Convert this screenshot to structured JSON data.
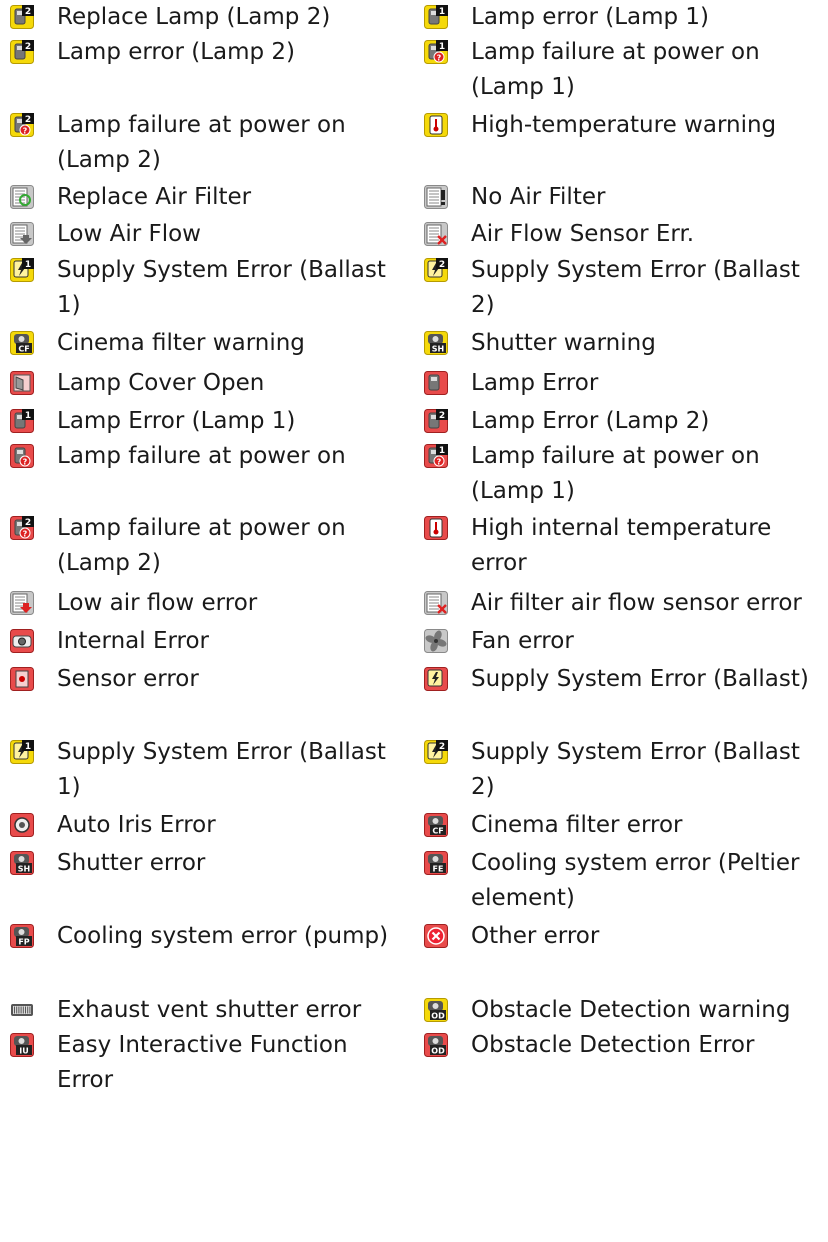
{
  "rows": [
    [
      {
        "label": "Replace Lamp (Lamp 2)",
        "icon": "lamp-2-warning-icon",
        "tone": "yellow",
        "glyph": "lamp",
        "badge": "2"
      },
      {
        "label": "Lamp error (Lamp 1)",
        "icon": "lamp-1-warning-icon",
        "tone": "yellow",
        "glyph": "lamp",
        "badge": "1"
      }
    ],
    [
      {
        "label": "Lamp error (Lamp 2)",
        "icon": "lamp-2-warning-icon",
        "tone": "yellow",
        "glyph": "lamp",
        "badge": "2"
      },
      {
        "label": "Lamp failure at power on (Lamp 1)",
        "icon": "lamp-1-failure-icon",
        "tone": "yellow",
        "glyph": "lamp-q",
        "badge": "1"
      }
    ],
    [
      {
        "label": "Lamp failure at power on (Lamp 2)",
        "icon": "lamp-2-failure-icon",
        "tone": "yellow",
        "glyph": "lamp-q",
        "badge": "2"
      },
      {
        "label": "High-temperature warning",
        "icon": "thermometer-warning-icon",
        "tone": "yellow",
        "glyph": "thermo"
      }
    ],
    [
      {
        "label": "Replace Air Filter",
        "icon": "replace-filter-icon",
        "tone": "gray",
        "glyph": "filter-cycle"
      },
      {
        "label": "No Air Filter",
        "icon": "no-filter-icon",
        "tone": "gray",
        "glyph": "filter-bang"
      }
    ],
    [
      {
        "label": "Low Air Flow",
        "icon": "low-airflow-icon",
        "tone": "gray",
        "glyph": "filter-down"
      },
      {
        "label": "Air Flow Sensor Err.",
        "icon": "airflow-sensor-error-icon",
        "tone": "gray",
        "glyph": "filter-x"
      }
    ],
    [
      {
        "label": "Supply System Error (Ballast 1)",
        "icon": "ballast-1-warning-icon",
        "tone": "yellow",
        "glyph": "bolt",
        "badge": "1"
      },
      {
        "label": "Supply System Error (Ballast 2)",
        "icon": "ballast-2-warning-icon",
        "tone": "yellow",
        "glyph": "bolt",
        "badge": "2"
      }
    ],
    [
      {
        "label": "Cinema filter warning",
        "icon": "cinema-filter-warning-icon",
        "tone": "yellow",
        "glyph": "code",
        "code": "CF"
      },
      {
        "label": "Shutter warning",
        "icon": "shutter-warning-icon",
        "tone": "yellow",
        "glyph": "code",
        "code": "SH"
      }
    ],
    [
      {
        "label": "Lamp Cover Open",
        "icon": "lamp-cover-open-icon",
        "tone": "red",
        "glyph": "cover"
      },
      {
        "label": "Lamp Error",
        "icon": "lamp-error-icon",
        "tone": "red",
        "glyph": "lamp"
      }
    ],
    [
      {
        "label": "Lamp Error (Lamp 1)",
        "icon": "lamp-1-error-icon",
        "tone": "red",
        "glyph": "lamp",
        "badge": "1"
      },
      {
        "label": "Lamp Error (Lamp 2)",
        "icon": "lamp-2-error-icon",
        "tone": "red",
        "glyph": "lamp",
        "badge": "2"
      }
    ],
    [
      {
        "label": "Lamp failure at power on",
        "icon": "lamp-failure-error-icon",
        "tone": "red",
        "glyph": "lamp-q"
      },
      {
        "label": "Lamp failure at power on (Lamp 1)",
        "icon": "lamp-1-failure-error-icon",
        "tone": "red",
        "glyph": "lamp-q",
        "badge": "1"
      }
    ],
    [
      {
        "label": "Lamp failure at power on (Lamp 2)",
        "icon": "lamp-2-failure-error-icon",
        "tone": "red",
        "glyph": "lamp-q",
        "badge": "2"
      },
      {
        "label": "High internal temperature error",
        "icon": "thermometer-error-icon",
        "tone": "red",
        "glyph": "thermo"
      }
    ],
    [
      {
        "label": "Low air flow error",
        "icon": "low-airflow-error-icon",
        "tone": "gray",
        "glyph": "filter-down-red"
      },
      {
        "label": "Air filter air flow sensor error",
        "icon": "airflow-sensor-error-icon",
        "tone": "gray",
        "glyph": "filter-x"
      }
    ],
    [
      {
        "label": "Internal Error",
        "icon": "internal-error-icon",
        "tone": "red",
        "glyph": "projector"
      },
      {
        "label": "Fan error",
        "icon": "fan-error-icon",
        "tone": "gray",
        "glyph": "fan"
      }
    ],
    [
      {
        "label": "Sensor error",
        "icon": "sensor-error-icon",
        "tone": "red",
        "glyph": "sensor"
      },
      {
        "label": "Supply System Error (Ballast)",
        "icon": "ballast-error-icon",
        "tone": "red",
        "glyph": "bolt"
      }
    ],
    [
      {
        "label": "Supply System Error (Ballast 1)",
        "icon": "ballast-1-warning-icon",
        "tone": "yellow",
        "glyph": "bolt",
        "badge": "1"
      },
      {
        "label": "Supply System Error (Ballast 2)",
        "icon": "ballast-2-warning-icon",
        "tone": "yellow",
        "glyph": "bolt",
        "badge": "2"
      }
    ],
    [
      {
        "label": "Auto Iris Error",
        "icon": "auto-iris-error-icon",
        "tone": "red",
        "glyph": "iris"
      },
      {
        "label": "Cinema filter error",
        "icon": "cinema-filter-error-icon",
        "tone": "red",
        "glyph": "code",
        "code": "CF"
      }
    ],
    [
      {
        "label": "Shutter error",
        "icon": "shutter-error-icon",
        "tone": "red",
        "glyph": "code",
        "code": "SH"
      },
      {
        "label": "Cooling system error (Peltier element)",
        "icon": "peltier-error-icon",
        "tone": "red",
        "glyph": "code",
        "code": "FE"
      }
    ],
    [
      {
        "label": "Cooling system error (pump)",
        "icon": "pump-error-icon",
        "tone": "red",
        "glyph": "code",
        "code": "FP"
      },
      {
        "label": "Other error",
        "icon": "other-error-icon",
        "tone": "red",
        "glyph": "x-circle"
      }
    ],
    [
      {
        "label": "Exhaust vent shutter error",
        "icon": "exhaust-vent-icon",
        "tone": "none",
        "glyph": "vent"
      },
      {
        "label": "Obstacle Detection warning",
        "icon": "obstacle-warning-icon",
        "tone": "yellow",
        "glyph": "code",
        "code": "OD"
      }
    ],
    [
      {
        "label": "Easy Interactive Function Error",
        "icon": "interactive-error-icon",
        "tone": "red",
        "glyph": "code",
        "code": "IU"
      },
      {
        "label": "Obstacle Detection Error",
        "icon": "obstacle-error-icon",
        "tone": "red",
        "glyph": "code",
        "code": "OD"
      }
    ]
  ],
  "palette": {
    "yellow": "#f5d90a",
    "red": "#e84b4b",
    "gray": "#c8c8c8",
    "text": "#1a1a1a"
  }
}
